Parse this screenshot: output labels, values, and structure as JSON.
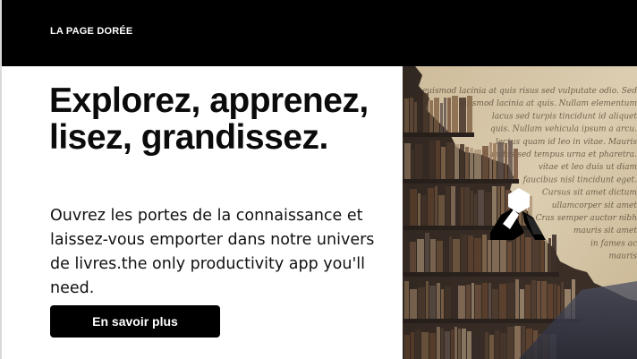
{
  "header": {
    "brand": "LA PAGE DORÉE"
  },
  "hero": {
    "headline": "Explorez, apprenez, lisez, grandissez.",
    "subtext": "Ouvrez les portes de la connaissance et laissez-vous emporter dans notre univers de livres.the only productivity app you'll need.",
    "cta_label": "En savoir plus"
  },
  "image": {
    "manuscript_lines": [
      "euismod lacinia at quis risus sed vulputate odio. Sed",
      "euismod lacinia at quis. Nullam elementum",
      "lacus sed turpis tincidunt id aliquet",
      "quis. Nullam vehicula ipsum a arcu.",
      "lectus quam id leo in vitae. Mauris",
      "Egestas sed tempus urna et pharetra.",
      "vitae et leo duis ut diam",
      "faucibus nisl tincidunt eget.",
      "Cursus sit amet dictum",
      "ullamcorper sit amet",
      "Cras semper auctor nibh",
      "mauris sit amet",
      "in fames ac",
      "mauris"
    ]
  },
  "colors": {
    "topbar": "#000000",
    "button": "#000000",
    "text": "#0b0b0b",
    "paper": "#d8c9ad"
  },
  "icons": {
    "logo": "abstract-hexagon-logo"
  }
}
